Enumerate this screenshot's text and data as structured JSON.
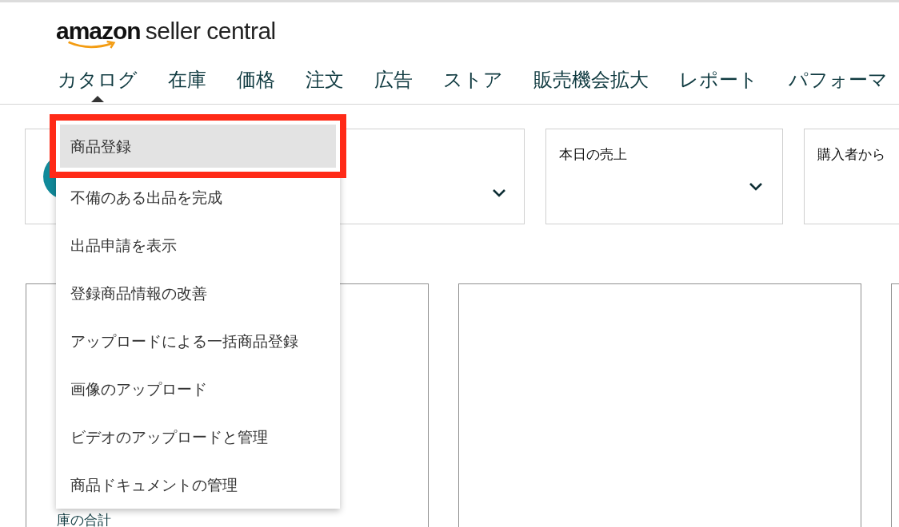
{
  "logo": {
    "brand": "amazon",
    "product": "seller central"
  },
  "nav": [
    {
      "label": "カタログ",
      "expanded": true
    },
    {
      "label": "在庫",
      "expanded": false
    },
    {
      "label": "価格",
      "expanded": false
    },
    {
      "label": "注文",
      "expanded": false
    },
    {
      "label": "広告",
      "expanded": false
    },
    {
      "label": "ストア",
      "expanded": false
    },
    {
      "label": "販売機会拡大",
      "expanded": false
    },
    {
      "label": "レポート",
      "expanded": false
    },
    {
      "label": "パフォーマ",
      "expanded": false
    }
  ],
  "menu": [
    {
      "label": "商品登録",
      "selected": true,
      "annotated": true
    },
    {
      "label": "不備のある出品を完成",
      "selected": false,
      "annotated": false
    },
    {
      "label": "出品申請を表示",
      "selected": false,
      "annotated": false
    },
    {
      "label": "登録商品情報の改善",
      "selected": false,
      "annotated": false
    },
    {
      "label": "アップロードによる一括商品登録",
      "selected": false,
      "annotated": false
    },
    {
      "label": "画像のアップロード",
      "selected": false,
      "annotated": false
    },
    {
      "label": "ビデオのアップロードと管理",
      "selected": false,
      "annotated": false
    },
    {
      "label": "商品ドキュメントの管理",
      "selected": false,
      "annotated": false
    }
  ],
  "summary_cards": [
    {
      "kind": "icon"
    },
    {
      "kind": "titled",
      "title": "本日の売上"
    },
    {
      "kind": "cut",
      "title": "購入者から"
    }
  ],
  "panels": [
    {
      "kind": "linked",
      "link": "庫の合計"
    },
    {
      "kind": "blank"
    },
    {
      "kind": "blank"
    }
  ]
}
